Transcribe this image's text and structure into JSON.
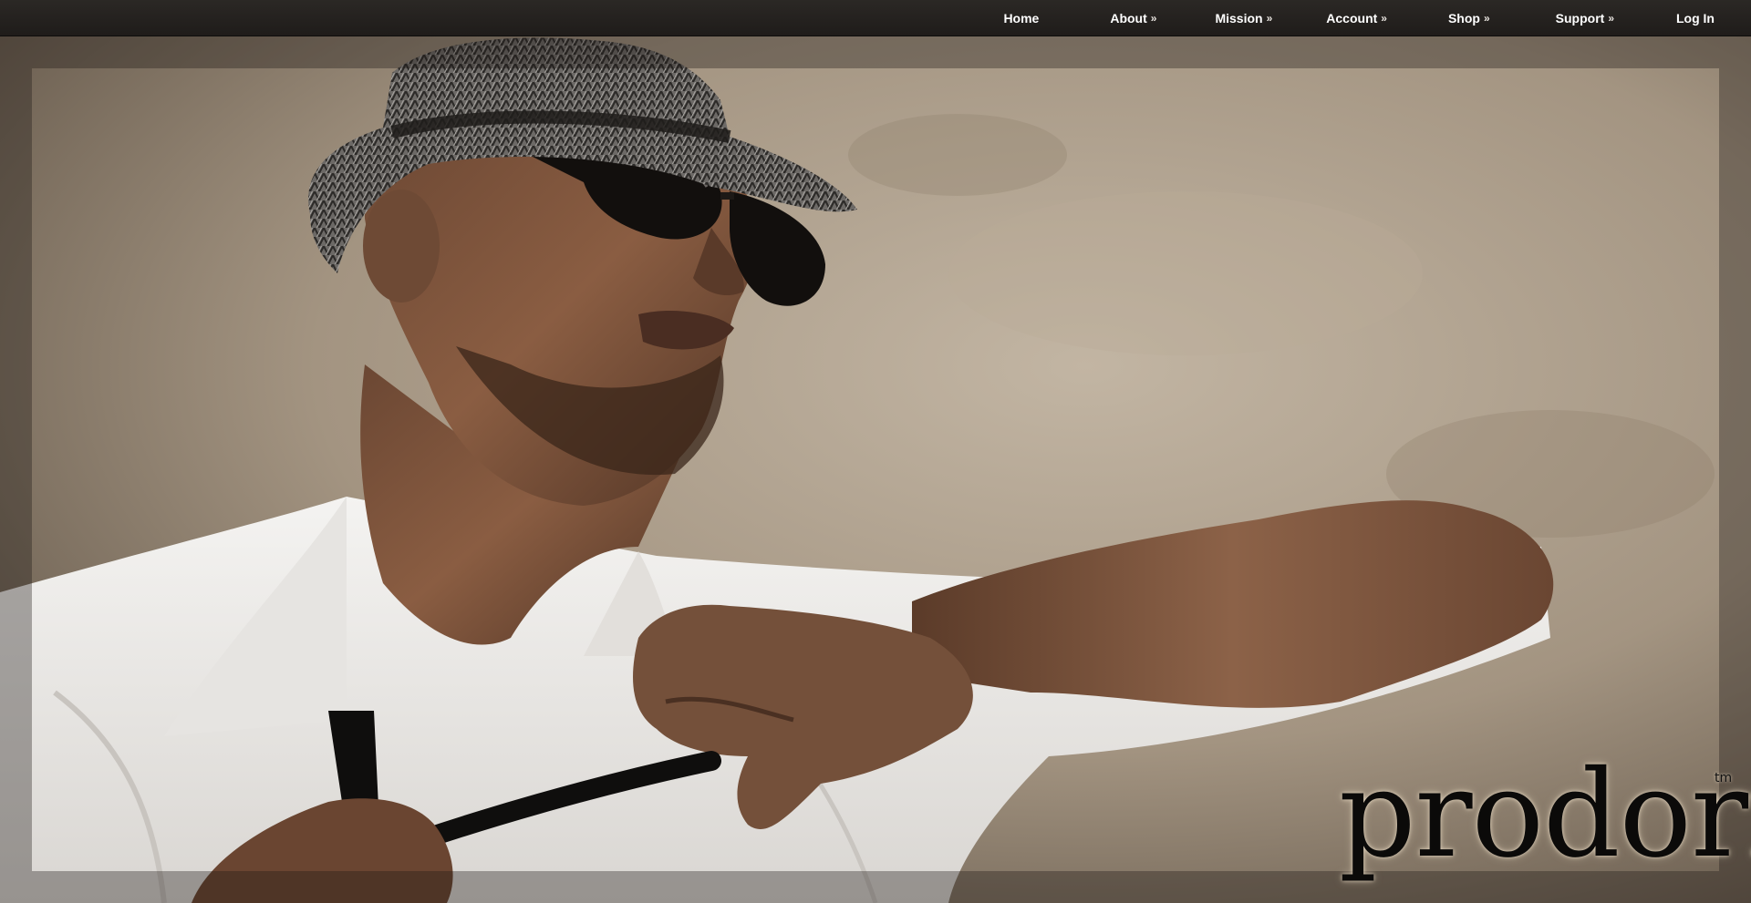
{
  "nav": {
    "items": [
      {
        "label": "Home",
        "has_submenu": false
      },
      {
        "label": "About",
        "has_submenu": true
      },
      {
        "label": "Mission",
        "has_submenu": true
      },
      {
        "label": "Account",
        "has_submenu": true
      },
      {
        "label": "Shop",
        "has_submenu": true
      },
      {
        "label": "Support",
        "has_submenu": true
      },
      {
        "label": "Log In",
        "has_submenu": false
      }
    ],
    "submenu_glyph": "»"
  },
  "hero": {
    "subject": "man in fedora and sunglasses loosening a black tie"
  },
  "brand": {
    "wordmark": "prodori",
    "trademark": "tm"
  },
  "colors": {
    "topbar": "#232020",
    "nav_text": "#ffffff",
    "backdrop": "#a89a89",
    "wordmark": "#0b0a09"
  }
}
